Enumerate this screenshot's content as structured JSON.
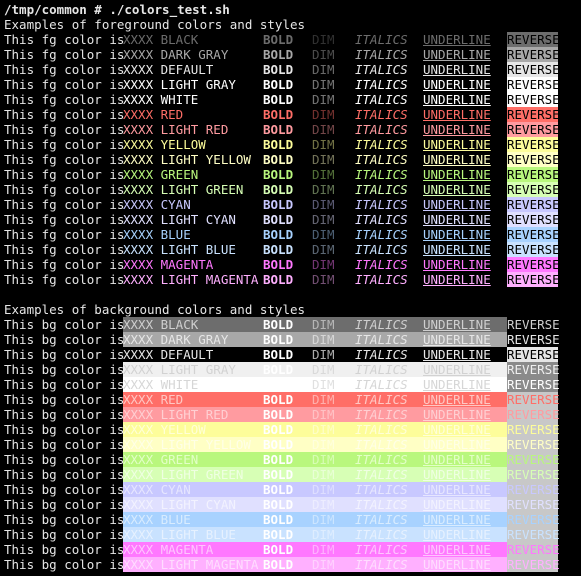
{
  "terminal": {
    "prompt": "/tmp/common # ./colors_test.sh",
    "fg_header": "Examples of foreground colors and styles",
    "bg_header": "Examples of background colors and styles",
    "fg_prefix": "This fg color is",
    "bg_prefix": "This bg color is",
    "style_words": {
      "bold": "BOLD",
      "dim": "DIM",
      "italics": "ITALICS",
      "underline": "UNDERLINE",
      "reverse": "REVERSE"
    },
    "fg_rows": [
      {
        "label": "XXXX BLACK",
        "color": "#6d6d6d"
      },
      {
        "label": "XXXX DARK GRAY",
        "color": "#a8a8a8"
      },
      {
        "label": "XXXX DEFAULT",
        "color": "#e6e6e6"
      },
      {
        "label": "XXXX LIGHT GRAY",
        "color": "#ffffff"
      },
      {
        "label": "XXXX WHITE",
        "color": "#ffffff"
      },
      {
        "label": "XXXX RED",
        "color": "#ff6e67"
      },
      {
        "label": "XXXX LIGHT RED",
        "color": "#ff9ba0"
      },
      {
        "label": "XXXX YELLOW",
        "color": "#fdfd9a"
      },
      {
        "label": "XXXX LIGHT YELLOW",
        "color": "#ffffc5"
      },
      {
        "label": "XXXX GREEN",
        "color": "#b9f77d"
      },
      {
        "label": "XXXX LIGHT GREEN",
        "color": "#d7ffb5"
      },
      {
        "label": "XXXX CYAN",
        "color": "#c8c8ff"
      },
      {
        "label": "XXXX LIGHT CYAN",
        "color": "#e0e0ff"
      },
      {
        "label": "XXXX BLUE",
        "color": "#a8d2ff"
      },
      {
        "label": "XXXX LIGHT BLUE",
        "color": "#c9e2ff"
      },
      {
        "label": "XXXX MAGENTA",
        "color": "#ff78ff"
      },
      {
        "label": "XXXX LIGHT MAGENTA",
        "color": "#ffb0ff"
      }
    ],
    "bg_rows": [
      {
        "label": "XXXX BLACK",
        "bg": "#6d6d6d",
        "fg": "#cfcfcf",
        "reverse_fg": "#cfcfcf",
        "reverse_bg": "#000000"
      },
      {
        "label": "XXXX DARK GRAY",
        "bg": "#a8a8a8",
        "fg": "#e6e6e6",
        "reverse_fg": "#e6e6e6",
        "reverse_bg": "#000000"
      },
      {
        "label": "XXXX DEFAULT",
        "bg": "#000000",
        "fg": "#e6e6e6",
        "reverse_fg": "#000000",
        "reverse_bg": "#e6e6e6"
      },
      {
        "label": "XXXX LIGHT GRAY",
        "bg": "#f0f0f0",
        "fg": "#d2d2d2",
        "reverse_fg": "#f0f0f0",
        "reverse_bg": "#8a8a8a"
      },
      {
        "label": "XXXX WHITE",
        "bg": "#ffffff",
        "fg": "#d6d6d6",
        "reverse_fg": "#ffffff",
        "reverse_bg": "#8a8a8a"
      },
      {
        "label": "XXXX RED",
        "bg": "#ff6e67",
        "fg": "#ffc7c3",
        "reverse_fg": "#ff6e67",
        "reverse_bg": "#c8c8c8"
      },
      {
        "label": "XXXX LIGHT RED",
        "bg": "#ff9ba0",
        "fg": "#ffcfd2",
        "reverse_fg": "#ff9ba0",
        "reverse_bg": "#c8c8c8"
      },
      {
        "label": "XXXX YELLOW",
        "bg": "#fdfd9a",
        "fg": "#ffffd6",
        "reverse_fg": "#fdfd9a",
        "reverse_bg": "#c8c8c8"
      },
      {
        "label": "XXXX LIGHT YELLOW",
        "bg": "#ffffc5",
        "fg": "#ffffe6",
        "reverse_fg": "#ffffc5",
        "reverse_bg": "#c8c8c8"
      },
      {
        "label": "XXXX GREEN",
        "bg": "#b9f77d",
        "fg": "#e2ffc7",
        "reverse_fg": "#b9f77d",
        "reverse_bg": "#c8c8c8"
      },
      {
        "label": "XXXX LIGHT GREEN",
        "bg": "#d7ffb5",
        "fg": "#efffe2",
        "reverse_fg": "#d7ffb5",
        "reverse_bg": "#c8c8c8"
      },
      {
        "label": "XXXX CYAN",
        "bg": "#c8c8ff",
        "fg": "#e6e6ff",
        "reverse_fg": "#c8c8ff",
        "reverse_bg": "#c8c8c8"
      },
      {
        "label": "XXXX LIGHT CYAN",
        "bg": "#e0e0ff",
        "fg": "#f2f2ff",
        "reverse_fg": "#e0e0ff",
        "reverse_bg": "#c8c8c8"
      },
      {
        "label": "XXXX BLUE",
        "bg": "#a8d2ff",
        "fg": "#d8ecff",
        "reverse_fg": "#a8d2ff",
        "reverse_bg": "#c8c8c8"
      },
      {
        "label": "XXXX LIGHT BLUE",
        "bg": "#c9e2ff",
        "fg": "#e6f1ff",
        "reverse_fg": "#c9e2ff",
        "reverse_bg": "#c8c8c8"
      },
      {
        "label": "XXXX MAGENTA",
        "bg": "#ff78ff",
        "fg": "#ffc4ff",
        "reverse_fg": "#ff78ff",
        "reverse_bg": "#c8c8c8"
      },
      {
        "label": "XXXX LIGHT MAGENTA",
        "bg": "#ffb0ff",
        "fg": "#ffdcff",
        "reverse_fg": "#ffb0ff",
        "reverse_bg": "#c8c8c8"
      }
    ]
  }
}
